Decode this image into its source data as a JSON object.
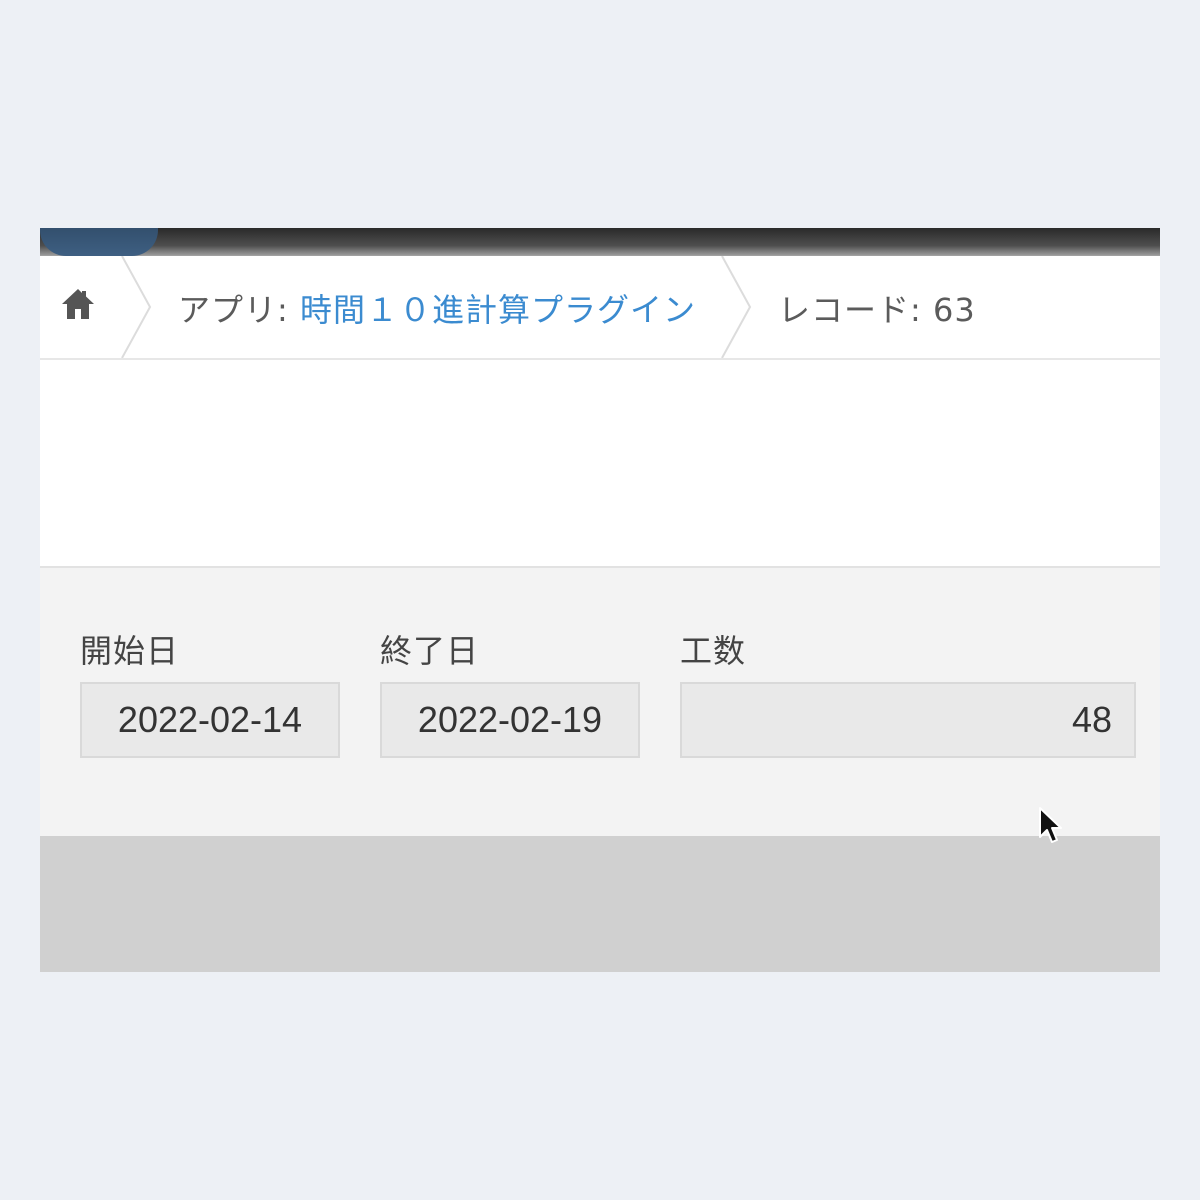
{
  "breadcrumb": {
    "home_icon": "home-icon",
    "app_prefix": "アプリ: ",
    "app_name": "時間１０進計算プラグイン",
    "record_label": "レコード: 63"
  },
  "fields": {
    "start_date": {
      "label": "開始日",
      "value": "2022-02-14"
    },
    "end_date": {
      "label": "終了日",
      "value": "2022-02-19"
    },
    "man_hours": {
      "label": "工数",
      "value": "48"
    }
  },
  "colors": {
    "link": "#3b8bd0",
    "page_background": "#edf0f5",
    "form_background": "#f3f3f3",
    "footer_background": "#d0d0d0"
  },
  "cursor_icon": "mouse-pointer-icon"
}
